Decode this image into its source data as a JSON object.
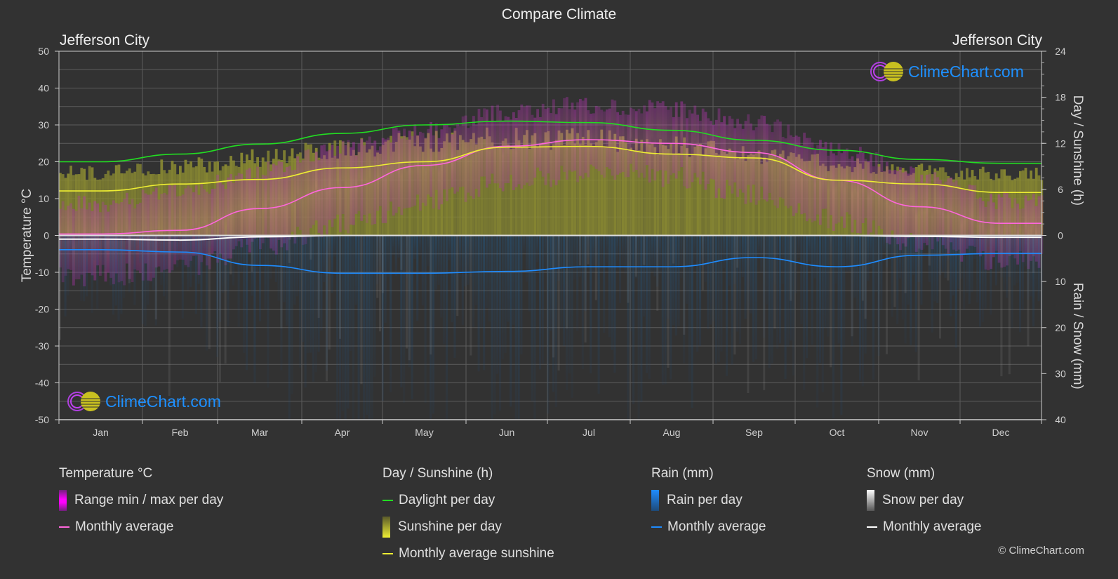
{
  "header": {
    "title": "Compare Climate",
    "city_left": "Jefferson City",
    "city_right": "Jefferson City"
  },
  "logo": {
    "text": "ClimeChart.com"
  },
  "copyright": "© ClimeChart.com",
  "colors": {
    "background": "#323232",
    "grid": "#5a5a5a",
    "temp_range": "#e020e0",
    "temp_avg": "#ff66dd",
    "daylight": "#22dd22",
    "sunshine_bar": "#c8c832",
    "sunshine_avg": "#eeee33",
    "rain_bar": "#1e78c8",
    "rain_avg": "#1e8cff",
    "snow_bar": "#aaaaaa",
    "snow_avg": "#ffffff",
    "logo_text": "#1e90ff"
  },
  "legend": {
    "groups": [
      {
        "title": "Temperature °C",
        "items": [
          {
            "type": "bar",
            "label": "Range min / max per day",
            "swatch": "temp_range"
          },
          {
            "type": "line",
            "label": "Monthly average",
            "swatch": "temp_avg"
          }
        ]
      },
      {
        "title": "Day / Sunshine (h)",
        "items": [
          {
            "type": "line",
            "label": "Daylight per day",
            "swatch": "daylight"
          },
          {
            "type": "bar",
            "label": "Sunshine per day",
            "swatch": "sunshine_bar"
          },
          {
            "type": "line",
            "label": "Monthly average sunshine",
            "swatch": "sunshine_avg"
          }
        ]
      },
      {
        "title": "Rain (mm)",
        "items": [
          {
            "type": "bar",
            "label": "Rain per day",
            "swatch": "rain_bar"
          },
          {
            "type": "line",
            "label": "Monthly average",
            "swatch": "rain_avg"
          }
        ]
      },
      {
        "title": "Snow (mm)",
        "items": [
          {
            "type": "bar",
            "label": "Snow per day",
            "swatch": "snow_bar"
          },
          {
            "type": "line",
            "label": "Monthly average",
            "swatch": "snow_avg"
          }
        ]
      }
    ]
  },
  "chart_data": {
    "type": "line",
    "title": "Compare Climate",
    "categories": [
      "Jan",
      "Feb",
      "Mar",
      "Apr",
      "May",
      "Jun",
      "Jul",
      "Aug",
      "Sep",
      "Oct",
      "Nov",
      "Dec"
    ],
    "y_left": {
      "label": "Temperature °C",
      "range": [
        -50,
        50
      ],
      "ticks": [
        50,
        40,
        30,
        20,
        10,
        0,
        -10,
        -20,
        -30,
        -40,
        -50
      ]
    },
    "y_right_top": {
      "label": "Day / Sunshine (h)",
      "range": [
        0,
        24
      ],
      "ticks": [
        24,
        18,
        12,
        6,
        0
      ]
    },
    "y_right_bottom": {
      "label": "Rain / Snow (mm)",
      "range": [
        0,
        40
      ],
      "ticks": [
        0,
        10,
        20,
        30,
        40
      ]
    },
    "grid": true,
    "series": [
      {
        "name": "Temperature monthly average",
        "axis": "temperature",
        "color_key": "temp_avg",
        "values": [
          0.4,
          1.4,
          7.3,
          13.0,
          19.0,
          24.2,
          26.0,
          25.0,
          22.5,
          15.0,
          7.8,
          3.3
        ]
      },
      {
        "name": "Daylight per day",
        "axis": "hours",
        "color_key": "daylight",
        "values": [
          9.6,
          10.6,
          11.9,
          13.3,
          14.4,
          14.9,
          14.7,
          13.7,
          12.4,
          11.1,
          9.9,
          9.4
        ]
      },
      {
        "name": "Monthly average sunshine",
        "axis": "hours",
        "color_key": "sunshine_avg",
        "values": [
          5.8,
          6.7,
          7.3,
          8.8,
          9.6,
          11.5,
          11.6,
          10.6,
          10.1,
          7.2,
          6.7,
          5.6
        ]
      },
      {
        "name": "Rain monthly average",
        "axis": "precip",
        "color_key": "rain_avg",
        "values": [
          3.1,
          3.6,
          6.5,
          8.2,
          8.2,
          7.8,
          6.8,
          6.8,
          4.8,
          6.8,
          4.3,
          3.9
        ]
      },
      {
        "name": "Snow monthly average",
        "axis": "precip",
        "color_key": "snow_avg",
        "values": [
          0.8,
          1.0,
          0.3,
          0,
          0,
          0,
          0,
          0,
          0,
          0,
          0.2,
          0.4
        ]
      }
    ],
    "temp_range_approx": {
      "min": [
        -8,
        -6,
        0,
        6,
        12,
        18,
        20,
        19,
        14,
        7,
        1,
        -4
      ],
      "max": [
        6,
        9,
        15,
        21,
        26,
        31,
        33,
        32,
        28,
        21,
        14,
        7
      ]
    },
    "legend_position": "bottom"
  }
}
